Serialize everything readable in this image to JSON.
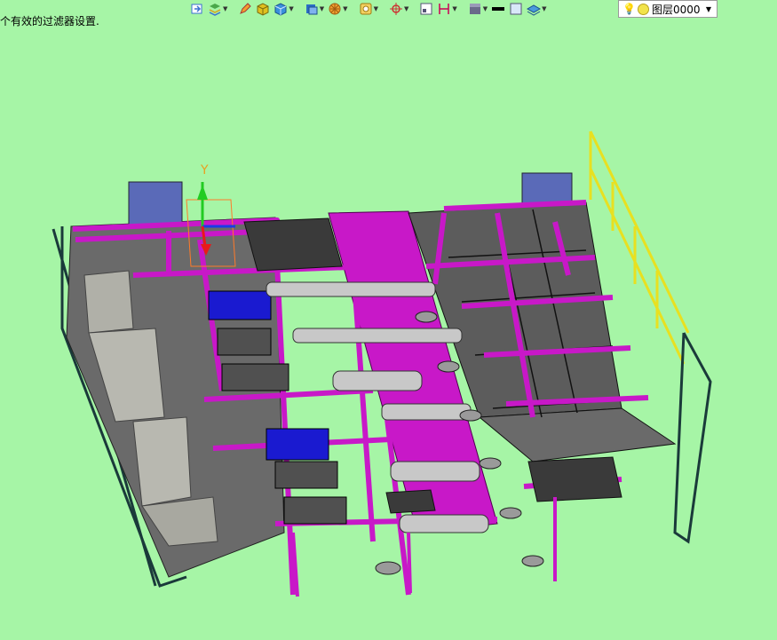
{
  "status_message": "个有效的过滤器设置.",
  "toolbar": {
    "buttons": [
      {
        "name": "import-icon",
        "color": "#3b6fd1"
      },
      {
        "name": "layers-manager-icon",
        "color": "#4aa84a"
      },
      {
        "name": "edit-icon",
        "color": "#c44"
      },
      {
        "name": "solid-box-icon",
        "color": "#e0c020"
      },
      {
        "name": "cube-icon",
        "color": "#3a8fdc"
      },
      {
        "name": "view-cube-icon",
        "color": "#2b6cc4"
      },
      {
        "name": "render-icon",
        "color": "#e08a1a"
      },
      {
        "name": "snap-icon",
        "color": "#d6a21a"
      },
      {
        "name": "ucs-icon",
        "color": "#c33"
      },
      {
        "name": "frame-icon",
        "color": "#557"
      },
      {
        "name": "dimension-icon",
        "color": "#c05"
      },
      {
        "name": "material-icon",
        "color": "#6a6a8a"
      },
      {
        "name": "line-weight-icon",
        "color": "#000"
      },
      {
        "name": "fill-icon",
        "color": "#88a"
      },
      {
        "name": "layer-state-icon",
        "color": "#4a9adb"
      }
    ]
  },
  "layer": {
    "name": "图层0000"
  },
  "axis": {
    "y_label": "Y"
  },
  "colors": {
    "background": "#a6f5a6",
    "frame_magenta": "#c818c8",
    "tank_gray": "#5c5c5c",
    "motor_blue": "#1a1ad0",
    "railing_yellow": "#e8e020"
  }
}
